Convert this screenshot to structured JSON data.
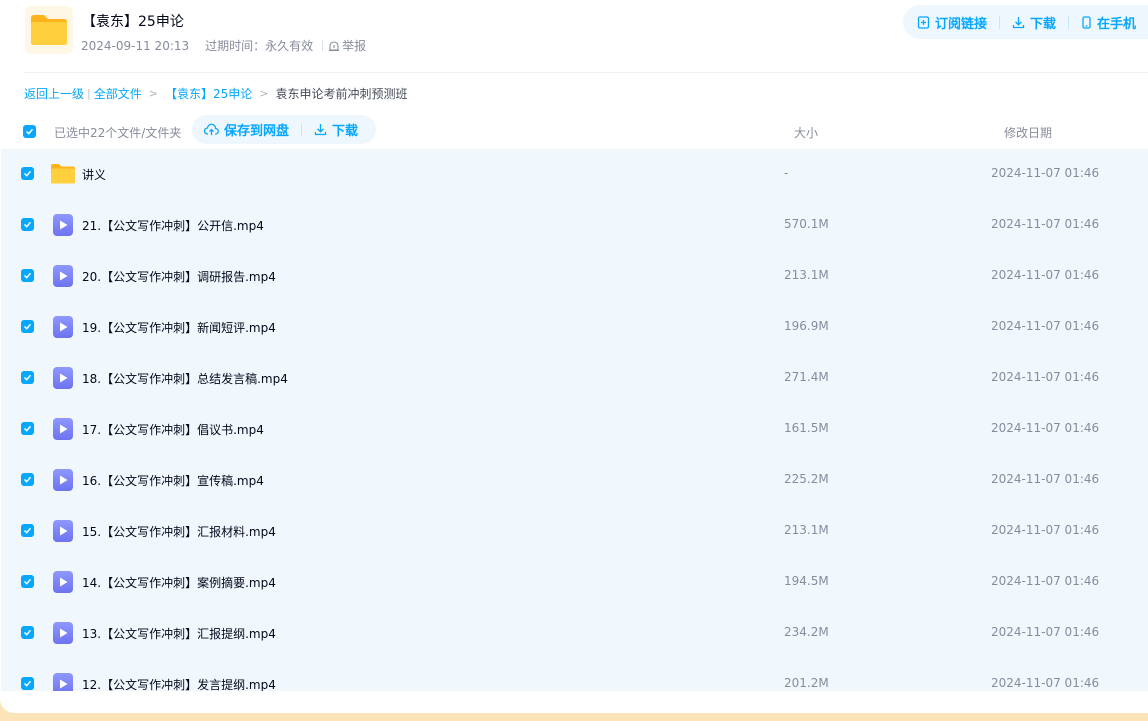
{
  "header": {
    "title": "【袁东】25申论",
    "date": "2024-09-11 20:13",
    "expiry": "过期时间：永久有效",
    "report": "举报"
  },
  "top_actions": {
    "subscribe": "订阅链接",
    "download": "下载",
    "phone": "在手机"
  },
  "breadcrumb": {
    "back": "返回上一级",
    "all_files": "全部文件",
    "parent": "【袁东】25申论",
    "current": "袁东申论考前冲刺预测班"
  },
  "toolbar": {
    "selected_info": "已选中22个文件/文件夹",
    "save_label": "保存到网盘",
    "download_label": "下载",
    "col_size": "大小",
    "col_date": "修改日期"
  },
  "colors": {
    "accent": "#06a7ff",
    "list_bg": "#f0f8fe",
    "video_icon": "#7b82f5",
    "folder_icon": "#ffc933"
  },
  "files": [
    {
      "name": "讲义",
      "size": "-",
      "date": "2024-11-07 01:46",
      "type": "folder",
      "checked": true
    },
    {
      "name": "21.【公文写作冲刺】公开信.mp4",
      "size": "570.1M",
      "date": "2024-11-07 01:46",
      "type": "video",
      "checked": true
    },
    {
      "name": "20.【公文写作冲刺】调研报告.mp4",
      "size": "213.1M",
      "date": "2024-11-07 01:46",
      "type": "video",
      "checked": true
    },
    {
      "name": "19.【公文写作冲刺】新闻短评.mp4",
      "size": "196.9M",
      "date": "2024-11-07 01:46",
      "type": "video",
      "checked": true
    },
    {
      "name": "18.【公文写作冲刺】总结发言稿.mp4",
      "size": "271.4M",
      "date": "2024-11-07 01:46",
      "type": "video",
      "checked": true
    },
    {
      "name": "17.【公文写作冲刺】倡议书.mp4",
      "size": "161.5M",
      "date": "2024-11-07 01:46",
      "type": "video",
      "checked": true
    },
    {
      "name": "16.【公文写作冲刺】宣传稿.mp4",
      "size": "225.2M",
      "date": "2024-11-07 01:46",
      "type": "video",
      "checked": true
    },
    {
      "name": "15.【公文写作冲刺】汇报材料.mp4",
      "size": "213.1M",
      "date": "2024-11-07 01:46",
      "type": "video",
      "checked": true
    },
    {
      "name": "14.【公文写作冲刺】案例摘要.mp4",
      "size": "194.5M",
      "date": "2024-11-07 01:46",
      "type": "video",
      "checked": true
    },
    {
      "name": "13.【公文写作冲刺】汇报提纲.mp4",
      "size": "234.2M",
      "date": "2024-11-07 01:46",
      "type": "video",
      "checked": true
    },
    {
      "name": "12.【公文写作冲刺】发言提纲.mp4",
      "size": "201.2M",
      "date": "2024-11-07 01:46",
      "type": "video",
      "checked": true
    }
  ]
}
